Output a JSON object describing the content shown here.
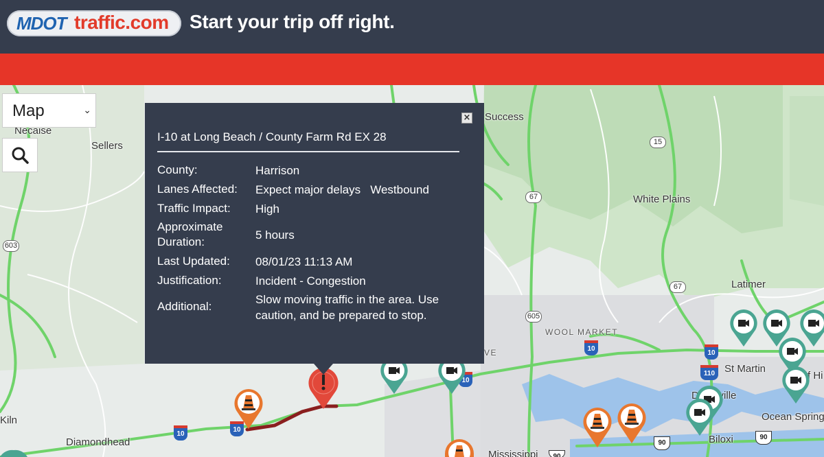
{
  "header": {
    "logo_mdot": "MDOT",
    "logo_traffic": "traffic.com",
    "tagline": "Start your trip off right."
  },
  "map_controls": {
    "map_type_selected": "Map",
    "search_icon": "search-icon",
    "chevron_icon": "chevron-down-icon"
  },
  "map_labels": {
    "necaise": "Necaise",
    "sellers": "Sellers",
    "success": "Success",
    "white_plains": "White Plains",
    "latimer": "Latimer",
    "wool_market": "WOOL MARKET",
    "st_martin": "St Martin",
    "d_ville": "D'Iberville",
    "ocean_springs": "Ocean Spring",
    "biloxi": "Biloxi",
    "kiln": "Kiln",
    "diamondhead": "Diamondhead",
    "mississippi": "Mississippi",
    "e_fragment": "VE",
    "hi_fragment": "f Hi"
  },
  "route_shields": {
    "r603": "603",
    "r15": "15",
    "r67a": "67",
    "r67b": "67",
    "r605": "605",
    "i10a": "10",
    "i10b": "10",
    "i10c": "10",
    "i10d": "10",
    "i10e": "10",
    "i110": "110",
    "us90a": "90",
    "us90b": "90",
    "us90c": "90"
  },
  "popup": {
    "title": "I-10 at Long Beach / County Farm Rd EX 28",
    "close_icon": "close-icon",
    "fields": [
      {
        "label": "County:",
        "value": "Harrison"
      },
      {
        "label": "Lanes Affected:",
        "value": "Expect major delays   Westbound"
      },
      {
        "label": "Traffic Impact:",
        "value": "High"
      },
      {
        "label": "Approximate Duration:",
        "value": "5 hours"
      },
      {
        "label": "Last Updated:",
        "value": "08/01/23 11:13 AM"
      },
      {
        "label": "Justification:",
        "value": "Incident - Congestion"
      },
      {
        "label": "Additional:",
        "value": "Slow moving traffic in the area. Use caution, and be prepared to stop."
      }
    ]
  },
  "colors": {
    "header_bg": "#353d4d",
    "red_bar": "#e63528",
    "popup_bg": "#353d4d",
    "road_green": "#6fd36a",
    "camera_teal": "#4aa592",
    "construction_orange": "#e8772e",
    "incident_red": "#e2483a"
  }
}
